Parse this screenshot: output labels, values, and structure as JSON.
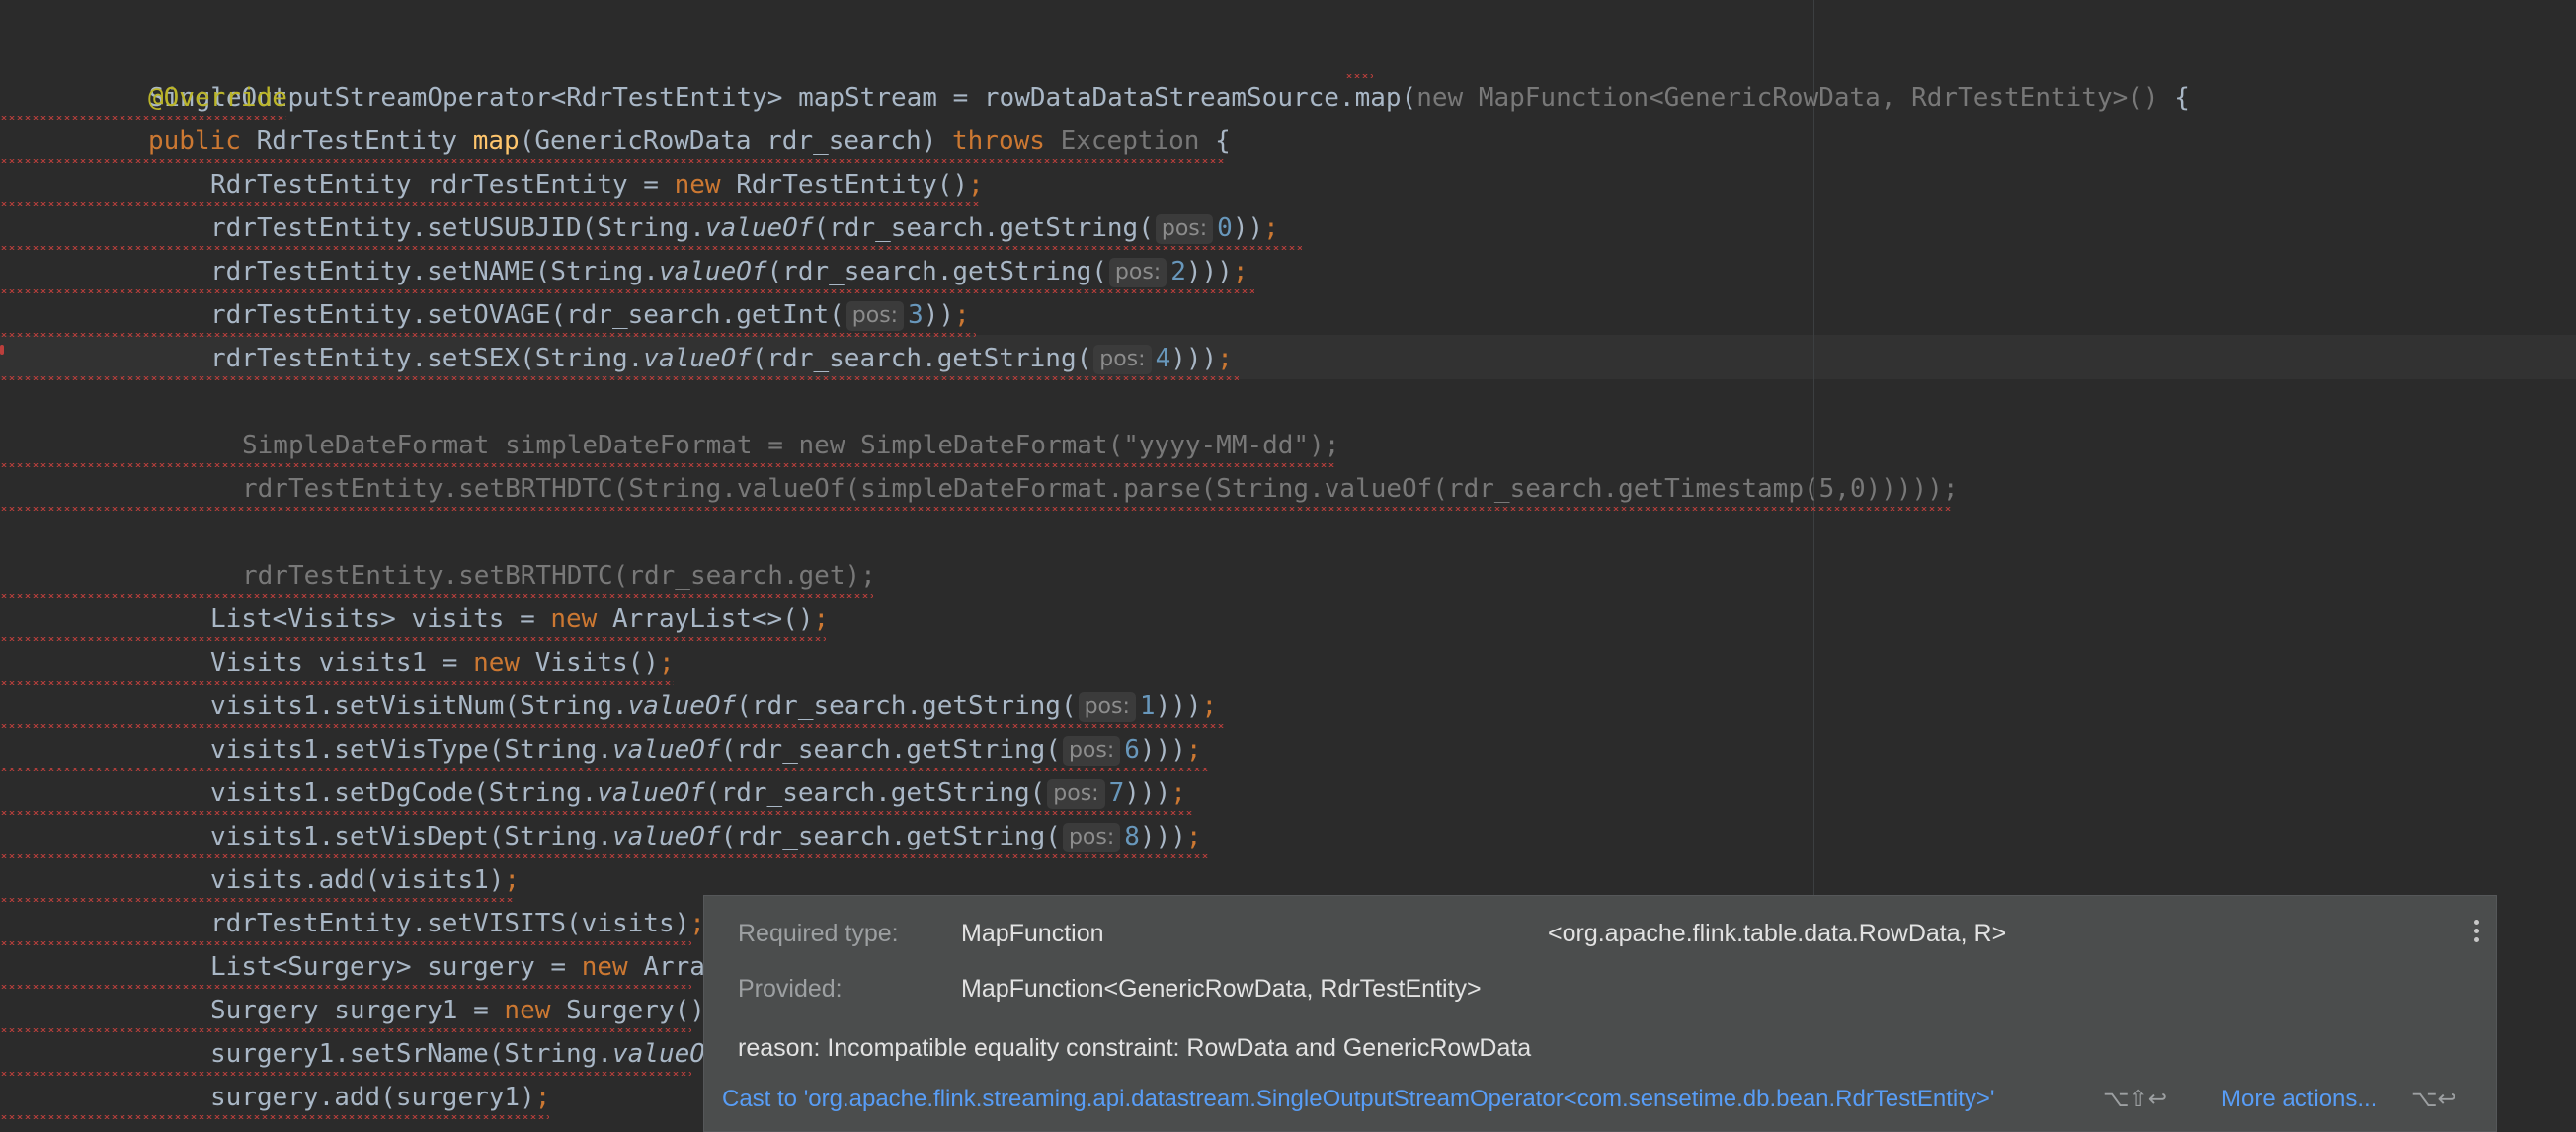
{
  "code": {
    "line1": {
      "prefix": "SingleOutputStreamOperator<RdrTestEntity> mapStream = rowDataDataStreamSource.map(",
      "new_gray": "new MapFunction<GenericRowData, RdrTestEntity>()",
      "suffix": " {"
    },
    "line2": {
      "annotation": "@Override"
    },
    "line3": {
      "public": "public ",
      "type": "RdrTestEntity ",
      "method": "map",
      "params": "(GenericRowData rdr_search) ",
      "throws": "throws ",
      "exception": "Exception",
      "brace": " {"
    },
    "line4": {
      "a": "RdrTestEntity rdrTestEntity = ",
      "new": "new ",
      "b": "RdrTestEntity()",
      "semi": ";"
    },
    "line5": {
      "a": "rdrTestEntity.setUSUBJID(String.",
      "valueOf": "valueOf",
      "b": "(rdr_search.getString(",
      "hint": "pos:",
      "num": "0",
      "c": "))",
      "semi": ";"
    },
    "line6": {
      "a": "rdrTestEntity.setNAME(String.",
      "valueOf": "valueOf",
      "b": "(rdr_search.getString(",
      "hint": "pos:",
      "num": "2",
      "c": ")))",
      "semi": ";"
    },
    "line7": {
      "a": "rdrTestEntity.setOVAGE(rdr_search.getInt(",
      "hint": "pos:",
      "num": "3",
      "c": "))",
      "semi": ";"
    },
    "line8": {
      "a": "rdrTestEntity.setSEX(String.",
      "valueOf": "valueOf",
      "b": "(rdr_search.getString(",
      "hint": "pos:",
      "num": "4",
      "c": ")))",
      "semi": ";"
    },
    "line9": {
      "text": "SimpleDateFormat simpleDateFormat = new SimpleDateFormat(\"yyyy-MM-dd\");"
    },
    "line10": {
      "text": "rdrTestEntity.setBRTHDTC(String.valueOf(simpleDateFormat.parse(String.valueOf(rdr_search.getTimestamp(5,0)))));"
    },
    "line11": {
      "text": "rdrTestEntity.setBRTHDTC(rdr_search.get);"
    },
    "line12": {
      "a": "List<Visits> visits = ",
      "new": "new ",
      "b": "ArrayList<>()",
      "semi": ";"
    },
    "line13": {
      "a": "Visits visits1 = ",
      "new": "new ",
      "b": "Visits()",
      "semi": ";"
    },
    "line14": {
      "a": "visits1.setVisitNum(String.",
      "valueOf": "valueOf",
      "b": "(rdr_search.getString(",
      "hint": "pos:",
      "num": "1",
      "c": ")))",
      "semi": ";"
    },
    "line15": {
      "a": "visits1.setVisType(String.",
      "valueOf": "valueOf",
      "b": "(rdr_search.getString(",
      "hint": "pos:",
      "num": "6",
      "c": ")))",
      "semi": ";"
    },
    "line16": {
      "a": "visits1.setDgCode(String.",
      "valueOf": "valueOf",
      "b": "(rdr_search.getString(",
      "hint": "pos:",
      "num": "7",
      "c": ")))",
      "semi": ";"
    },
    "line17": {
      "a": "visits1.setVisDept(String.",
      "valueOf": "valueOf",
      "b": "(rdr_search.getString(",
      "hint": "pos:",
      "num": "8",
      "c": ")))",
      "semi": ";"
    },
    "line18": {
      "a": "visits.add(visits1)",
      "semi": ";"
    },
    "line19": {
      "a": "rdrTestEntity.setVISITS(visits)",
      "semi": ";"
    },
    "line20": {
      "a": "List<Surgery> surgery = ",
      "new": "new ",
      "b": "Arra"
    },
    "line21": {
      "a": "Surgery surgery1 = ",
      "new": "new ",
      "b": "Surgery()"
    },
    "line22": {
      "a": "surgery1.setSrName(String.",
      "valueOf": "valueO"
    },
    "line23": {
      "a": "surgery.add(surgery1)",
      "semi": ";"
    }
  },
  "popup": {
    "required_label": "Required type:",
    "required_value": "MapFunction",
    "required_generic": "<org.apache.flink.table.data.RowData, R>",
    "provided_label": "Provided:",
    "provided_value": "MapFunction<GenericRowData, RdrTestEntity>",
    "reason": "reason: Incompatible equality constraint: RowData and GenericRowData",
    "cast_action": "Cast to 'org.apache.flink.streaming.api.datastream.SingleOutputStreamOperator<com.sensetime.db.bean.RdrTestEntity>'",
    "cast_shortcut": "⌥⇧↩",
    "more_actions": "More actions...",
    "more_shortcut": "⌥↩"
  },
  "colors": {
    "background": "#2b2b2b",
    "keyword": "#cc7832",
    "annotation": "#bbb529",
    "method": "#ffc66d",
    "number": "#6897bb",
    "error_squiggle": "#bc3f3c",
    "link": "#589df6",
    "popup_bg": "#4b4d4d"
  }
}
